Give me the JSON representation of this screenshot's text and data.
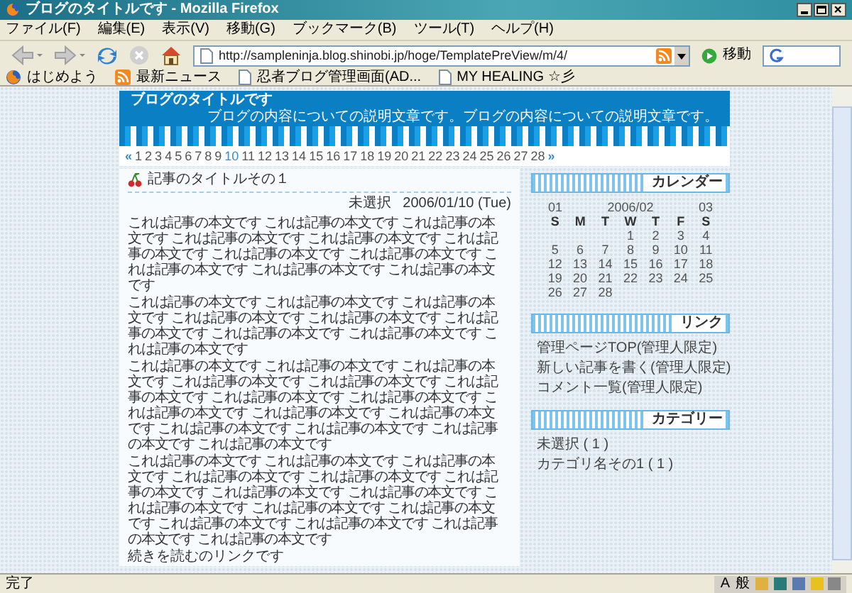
{
  "window": {
    "title": "ブログのタイトルです - Mozilla Firefox"
  },
  "menu": [
    "ファイル(F)",
    "編集(E)",
    "表示(V)",
    "移動(G)",
    "ブックマーク(B)",
    "ツール(T)",
    "ヘルプ(H)"
  ],
  "toolbar": {
    "url": "http://sampleninja.blog.shinobi.jp/hoge/TemplatePreView/m/4/",
    "go": "移動"
  },
  "bookmarks": [
    {
      "kind": "firefox",
      "label": "はじめよう"
    },
    {
      "kind": "feed",
      "label": "最新ニュース"
    },
    {
      "kind": "page",
      "label": "忍者ブログ管理画面(AD..."
    },
    {
      "kind": "page",
      "label": "MY HEALING ☆彡"
    }
  ],
  "blog": {
    "title": "ブログのタイトルです",
    "description": "ブログの内容についての説明文章です。ブログの内容についての説明文章です。",
    "prev": "«",
    "next": "»",
    "pages": [
      {
        "label": "1",
        "selected": false
      },
      {
        "label": "2",
        "selected": false
      },
      {
        "label": "3",
        "selected": false
      },
      {
        "label": "4",
        "selected": false
      },
      {
        "label": "5",
        "selected": false
      },
      {
        "label": "6",
        "selected": false
      },
      {
        "label": "7",
        "selected": false
      },
      {
        "label": "8",
        "selected": false
      },
      {
        "label": "9",
        "selected": false
      },
      {
        "label": "10",
        "selected": true
      },
      {
        "label": "11",
        "selected": false
      },
      {
        "label": "12",
        "selected": false
      },
      {
        "label": "13",
        "selected": false
      },
      {
        "label": "14",
        "selected": false
      },
      {
        "label": "15",
        "selected": false
      },
      {
        "label": "16",
        "selected": false
      },
      {
        "label": "17",
        "selected": false
      },
      {
        "label": "18",
        "selected": false
      },
      {
        "label": "19",
        "selected": false
      },
      {
        "label": "20",
        "selected": false
      },
      {
        "label": "21",
        "selected": false
      },
      {
        "label": "22",
        "selected": false
      },
      {
        "label": "23",
        "selected": false
      },
      {
        "label": "24",
        "selected": false
      },
      {
        "label": "25",
        "selected": false
      },
      {
        "label": "26",
        "selected": false
      },
      {
        "label": "27",
        "selected": false
      },
      {
        "label": "28",
        "selected": false
      }
    ]
  },
  "post": {
    "title": "記事のタイトルその１",
    "category": "未選択",
    "date": "2006/01/10 (Tue)",
    "paragraphs": [
      "これは記事の本文です これは記事の本文です これは記事の本文です これは記事の本文です これは記事の本文です これは記事の本文です これは記事の本文です これは記事の本文です これは記事の本文です これは記事の本文です これは記事の本文です",
      "これは記事の本文です これは記事の本文です これは記事の本文です これは記事の本文です これは記事の本文です これは記事の本文です これは記事の本文です これは記事の本文です これは記事の本文です",
      "これは記事の本文です これは記事の本文です これは記事の本文です これは記事の本文です これは記事の本文です これは記事の本文です これは記事の本文です これは記事の本文です これは記事の本文です これは記事の本文です これは記事の本文です これは記事の本文です これは記事の本文です これは記事の本文です これは記事の本文です",
      "これは記事の本文です これは記事の本文です これは記事の本文です これは記事の本文です これは記事の本文です これは記事の本文です これは記事の本文です これは記事の本文です これは記事の本文です これは記事の本文です これは記事の本文です これは記事の本文です これは記事の本文です これは記事の本文です これは記事の本文です"
    ],
    "more_link": "続きを読むのリンクです"
  },
  "sidebar": [
    {
      "kind": "calendar",
      "heading": "カレンダー",
      "prev": "01",
      "month": "2006/02",
      "next": "03",
      "weekdays": [
        "S",
        "M",
        "T",
        "W",
        "T",
        "F",
        "S"
      ],
      "weeks": [
        [
          "1",
          "2",
          "3",
          "4"
        ],
        [
          "5",
          "6",
          "7",
          "8",
          "9",
          "10",
          "11"
        ],
        [
          "12",
          "13",
          "14",
          "15",
          "16",
          "17",
          "18"
        ],
        [
          "19",
          "20",
          "21",
          "22",
          "23",
          "24",
          "25"
        ],
        [
          "26",
          "27",
          "28"
        ]
      ]
    },
    {
      "kind": "links",
      "heading": "リンク",
      "items": [
        "管理ページTOP(管理人限定)",
        "新しい記事を書く(管理人限定)",
        "コメント一覧(管理人限定)"
      ]
    },
    {
      "kind": "links",
      "heading": "カテゴリー",
      "items": [
        "未選択 ( 1 )",
        "カテゴリ名その1 ( 1 )"
      ]
    }
  ],
  "status_bar": {
    "text": "完了",
    "ime": [
      "A",
      "般"
    ]
  }
}
